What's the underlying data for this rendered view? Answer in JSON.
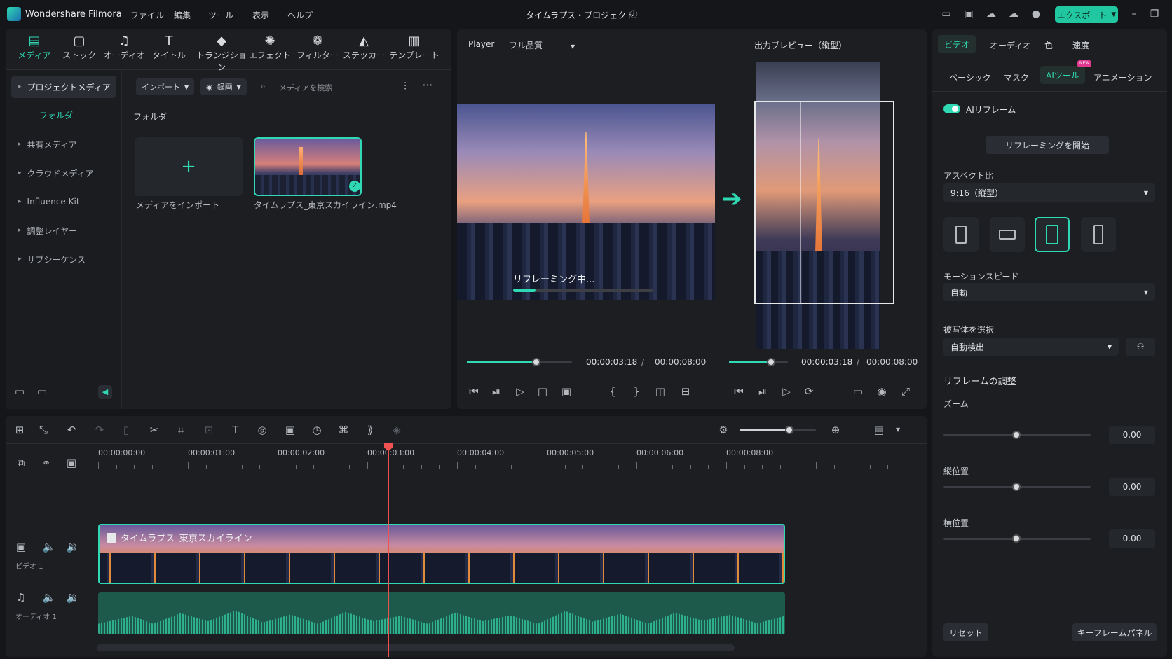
{
  "app": {
    "name": "Wondershare Filmora",
    "project": "タイムラプス・プロジェクト",
    "export_label": "エクスポート"
  },
  "menus": [
    "ファイル",
    "編集",
    "ツール",
    "表示",
    "ヘルプ"
  ],
  "media_tabs": [
    {
      "label": "メディア",
      "icon": "media-icon"
    },
    {
      "label": "ストック",
      "icon": "stock-icon"
    },
    {
      "label": "オーディオ",
      "icon": "audio-icon"
    },
    {
      "label": "タイトル",
      "icon": "title-icon"
    },
    {
      "label": "トランジション",
      "icon": "transition-icon"
    },
    {
      "label": "エフェクト",
      "icon": "effect-icon"
    },
    {
      "label": "フィルター",
      "icon": "filter-icon"
    },
    {
      "label": "ステッカー",
      "icon": "sticker-icon"
    },
    {
      "label": "テンプレート",
      "icon": "template-icon"
    }
  ],
  "sidebar": {
    "project_media": "プロジェクトメディア",
    "folder": "フォルダ",
    "items": [
      "共有メディア",
      "クラウドメディア",
      "Influence Kit",
      "調整レイヤー",
      "サブシーケンス"
    ]
  },
  "media": {
    "import_label": "インポート",
    "record_label": "録画",
    "search_placeholder": "メディアを検索",
    "folder_heading": "フォルダ",
    "import_tile": "メディアをインポート",
    "clip_name": "タイムラプス_東京スカイライン.mp4"
  },
  "player": {
    "label": "Player",
    "quality": "フル品質",
    "output_title": "出力プレビュー（縦型）",
    "overlay": "リフレーミング中...",
    "progress": 0.16,
    "current": "00:00:03:18",
    "total": "00:00:08:00",
    "sep": "/",
    "current2": "00:00:03:18",
    "total2": "00:00:08:00",
    "scrub": 0.66,
    "scrub2": 0.72
  },
  "props": {
    "tabs": [
      "ビデオ",
      "オーディオ",
      "色",
      "速度"
    ],
    "subtabs": [
      "ベーシック",
      "マスク",
      "AIツール",
      "アニメーション"
    ],
    "new_badge": "NEW",
    "ai_reframe": "AIリフレーム",
    "start_btn": "リフレーミングを開始",
    "aspect_label": "アスペクト比",
    "aspect_value": "9:16（縦型）",
    "motion_label": "モーションスピード",
    "motion_value": "自動",
    "subject_label": "被写体を選択",
    "subject_value": "自動検出",
    "adjust_label": "リフレームの調整",
    "zoom_label": "ズーム",
    "zoom_value": "0.00",
    "vpos_label": "縦位置",
    "vpos_value": "0.00",
    "hpos_label": "横位置",
    "hpos_value": "0.00",
    "reset": "リセット",
    "keyframe": "キーフレームパネル"
  },
  "timeline": {
    "ticks": [
      "00:00:00:00",
      "00:00:01:00",
      "00:00:02:00",
      "00:00:03:00",
      "00:00:04:00",
      "00:00:05:00",
      "00:00:06:00",
      "00:00:08:00"
    ],
    "video_track": "ビデオ 1",
    "audio_track": "オーディオ 1",
    "clip_title": "タイムラプス_東京スカイライン",
    "zoom": 0.65
  },
  "colors": {
    "accent": "#2fd9b3",
    "playhead": "#f05252",
    "audio": "#2a8f73"
  }
}
